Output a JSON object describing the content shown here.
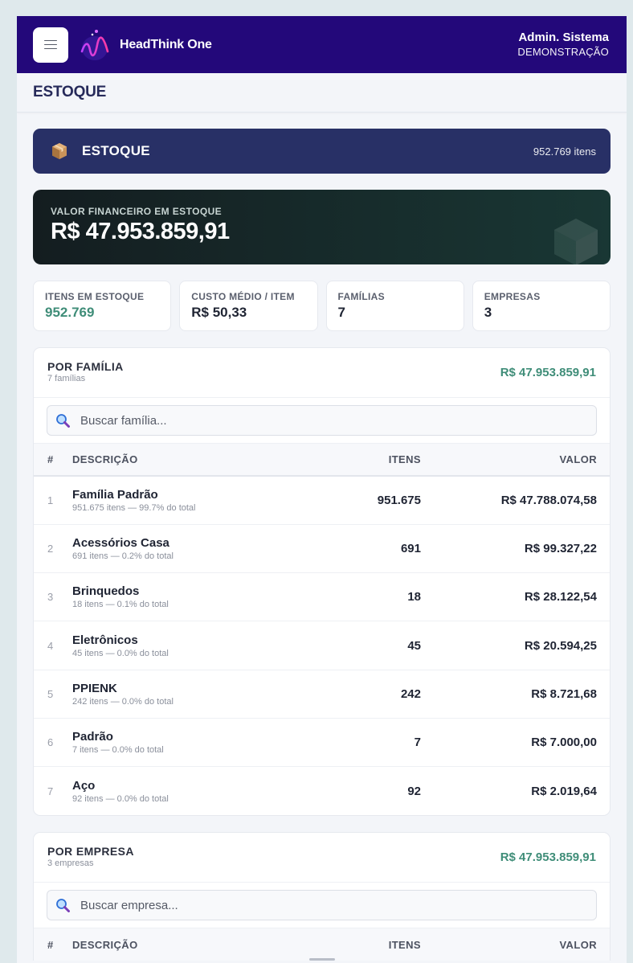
{
  "app": {
    "brand": "HeadThink One",
    "user_name": "Admin. Sistema",
    "user_org": "DEMONSTRAÇÃO"
  },
  "page": {
    "title": "ESTOQUE"
  },
  "banner": {
    "title": "ESTOQUE",
    "count": "952.769 itens"
  },
  "financial": {
    "label": "VALOR FINANCEIRO EM ESTOQUE",
    "amount": "R$ 47.953.859,91"
  },
  "kpis": [
    {
      "label": "ITENS EM ESTOQUE",
      "value": "952.769"
    },
    {
      "label": "CUSTO MÉDIO / ITEM",
      "value": "R$ 50,33"
    },
    {
      "label": "FAMÍLIAS",
      "value": "7"
    },
    {
      "label": "EMPRESAS",
      "value": "3"
    }
  ],
  "families": {
    "title": "POR FAMÍLIA",
    "subtitle": "7 famílias",
    "total": "R$ 47.953.859,91",
    "search_placeholder": "Buscar família...",
    "columns": {
      "num": "#",
      "desc": "DESCRIÇÃO",
      "items": "ITENS",
      "value": "VALOR"
    },
    "rows": [
      {
        "num": "1",
        "name": "Família Padrão",
        "sub": "951.675 itens — 99.7% do total",
        "items": "951.675",
        "value": "R$ 47.788.074,58"
      },
      {
        "num": "2",
        "name": "Acessórios Casa",
        "sub": "691 itens — 0.2% do total",
        "items": "691",
        "value": "R$ 99.327,22"
      },
      {
        "num": "3",
        "name": "Brinquedos",
        "sub": "18 itens — 0.1% do total",
        "items": "18",
        "value": "R$ 28.122,54"
      },
      {
        "num": "4",
        "name": "Eletrônicos",
        "sub": "45 itens — 0.0% do total",
        "items": "45",
        "value": "R$ 20.594,25"
      },
      {
        "num": "5",
        "name": "PPIENK",
        "sub": "242 itens — 0.0% do total",
        "items": "242",
        "value": "R$ 8.721,68"
      },
      {
        "num": "6",
        "name": "Padrão",
        "sub": "7 itens — 0.0% do total",
        "items": "7",
        "value": "R$ 7.000,00"
      },
      {
        "num": "7",
        "name": "Aço",
        "sub": "92 itens — 0.0% do total",
        "items": "92",
        "value": "R$ 2.019,64"
      }
    ]
  },
  "companies": {
    "title": "POR EMPRESA",
    "subtitle": "3 empresas",
    "total": "R$ 47.953.859,91",
    "search_placeholder": "Buscar empresa...",
    "columns": {
      "num": "#",
      "desc": "DESCRIÇÃO",
      "items": "ITENS",
      "value": "VALOR"
    }
  },
  "icons": {
    "menu": "hamburger-icon",
    "logo": "wave-logo-icon",
    "banner": "package-box-icon",
    "search": "magnifier-icon",
    "watermark": "cube-icon"
  },
  "colors": {
    "topbar": "#23087a",
    "banner": "#283066",
    "accent_green": "#3f8d78"
  }
}
